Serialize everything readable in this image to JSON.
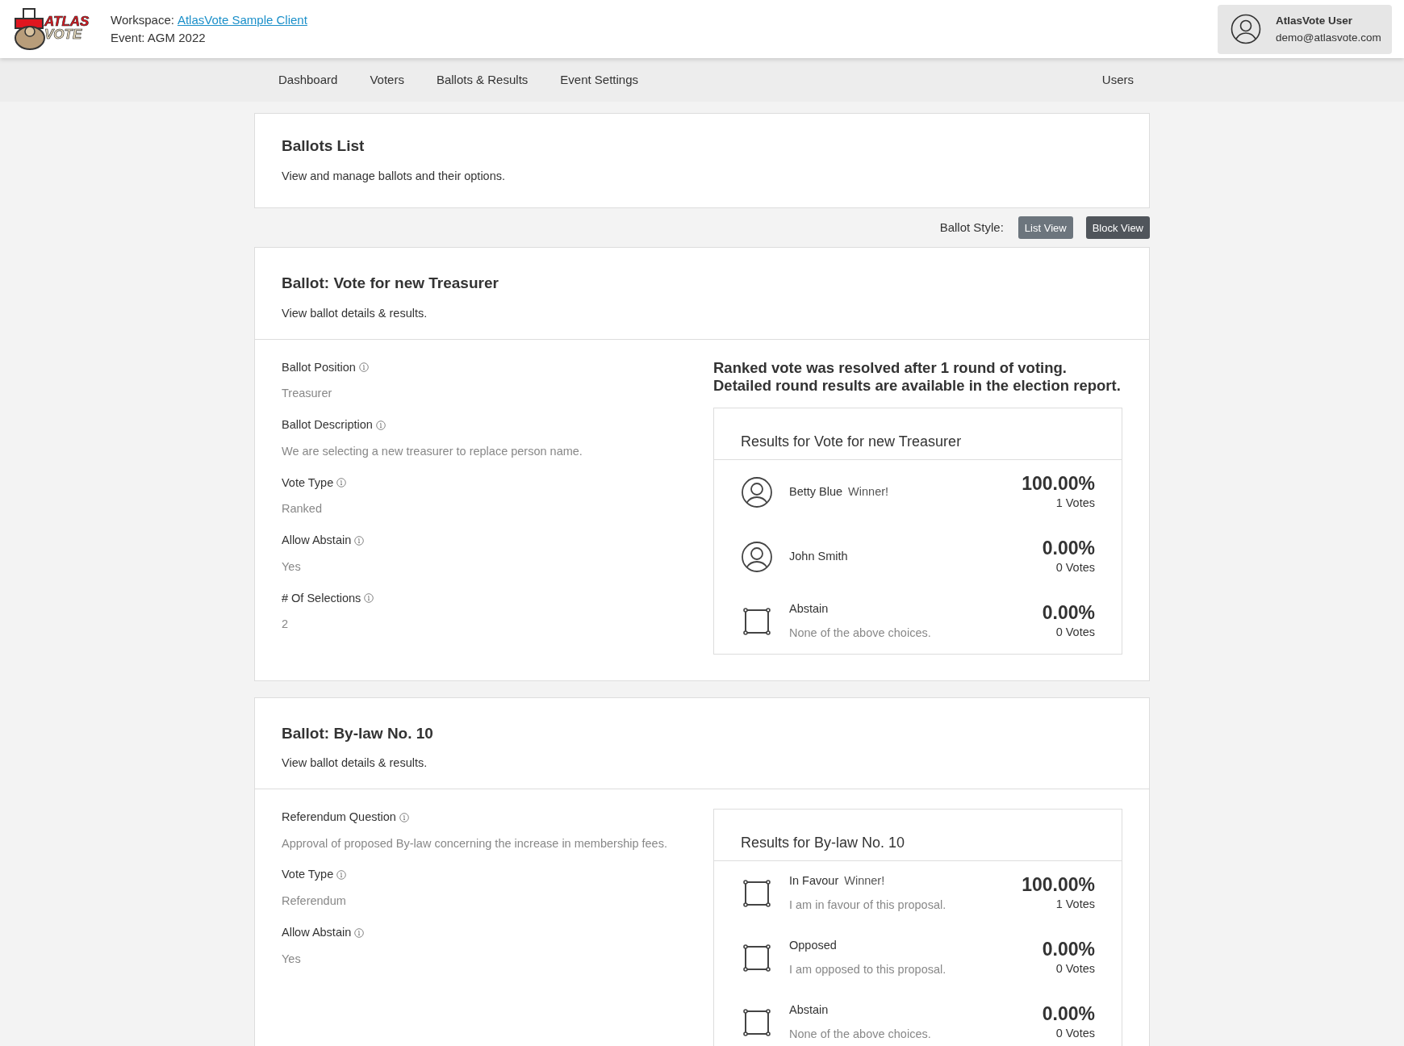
{
  "header": {
    "logo_text": [
      "ATLAS",
      "VOTE"
    ],
    "workspace_label": "Workspace:",
    "workspace_link": "AtlasVote Sample Client",
    "event": "Event: AGM 2022",
    "user": {
      "name": "AtlasVote User",
      "email": "demo@atlasvote.com"
    }
  },
  "nav": {
    "left": [
      "Dashboard",
      "Voters",
      "Ballots & Results",
      "Event Settings"
    ],
    "right": [
      "Users"
    ]
  },
  "page_header": {
    "title": "Ballots List",
    "subtitle": "View and manage ballots and their options."
  },
  "ballot_style": {
    "label": "Ballot Style:",
    "buttons": [
      {
        "label": "List View",
        "selected": false
      },
      {
        "label": "Block View",
        "selected": true
      }
    ]
  },
  "ballots": [
    {
      "title": "Ballot: Vote for new Treasurer",
      "subtitle": "View ballot details & results.",
      "fields": [
        {
          "label": "Ballot Position",
          "value": "Treasurer"
        },
        {
          "label": "Ballot Description",
          "value": "We are selecting a new treasurer to replace person name."
        },
        {
          "label": "Vote Type",
          "value": "Ranked"
        },
        {
          "label": "Allow Abstain",
          "value": "Yes"
        },
        {
          "label": "# Of Selections",
          "value": "2"
        }
      ],
      "summary": "Ranked vote was resolved after 1 round of voting. Detailed round results are available in the election report.",
      "results": {
        "title": "Results for Vote for new Treasurer",
        "options": [
          {
            "kind": "person",
            "name": "Betty Blue",
            "winner_label": "Winner!",
            "percent": "100.00%",
            "votes": "1 Votes"
          },
          {
            "kind": "person",
            "name": "John Smith",
            "percent": "0.00%",
            "votes": "0 Votes"
          },
          {
            "kind": "option",
            "name": "Abstain",
            "description": "None of the above choices.",
            "percent": "0.00%",
            "votes": "0 Votes"
          }
        ]
      }
    },
    {
      "title": "Ballot: By-law No. 10",
      "subtitle": "View ballot details & results.",
      "fields": [
        {
          "label": "Referendum Question",
          "value": "Approval of proposed By-law concerning the increase in membership fees."
        },
        {
          "label": "Vote Type",
          "value": "Referendum"
        },
        {
          "label": "Allow Abstain",
          "value": "Yes"
        }
      ],
      "results": {
        "title": "Results for By-law No. 10",
        "options": [
          {
            "kind": "option",
            "name": "In Favour",
            "winner_label": "Winner!",
            "description": "I am in favour of this proposal.",
            "percent": "100.00%",
            "votes": "1 Votes"
          },
          {
            "kind": "option",
            "name": "Opposed",
            "description": "I am opposed to this proposal.",
            "percent": "0.00%",
            "votes": "0 Votes"
          },
          {
            "kind": "option",
            "name": "Abstain",
            "description": "None of the above choices.",
            "percent": "0.00%",
            "votes": "0 Votes"
          }
        ]
      }
    }
  ]
}
